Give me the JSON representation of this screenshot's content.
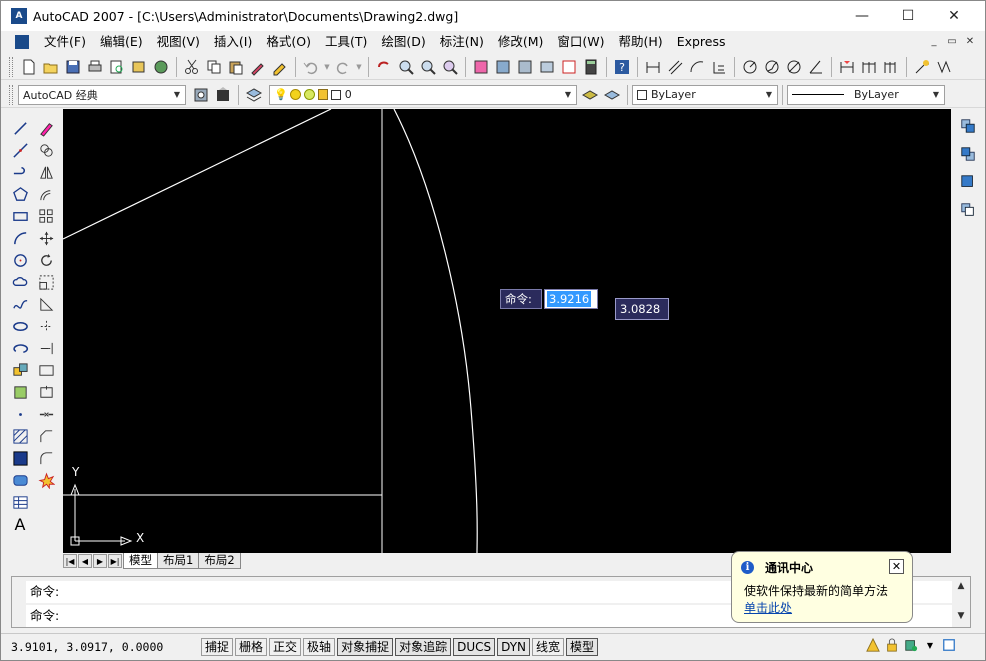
{
  "window": {
    "title": "AutoCAD 2007 - [C:\\Users\\Administrator\\Documents\\Drawing2.dwg]",
    "app_icon_text": "A",
    "minimize": "—",
    "maximize": "☐",
    "close": "✕"
  },
  "menubar": {
    "items": [
      "文件(F)",
      "编辑(E)",
      "视图(V)",
      "插入(I)",
      "格式(O)",
      "工具(T)",
      "绘图(D)",
      "标注(N)",
      "修改(M)",
      "窗口(W)",
      "帮助(H)",
      "Express"
    ],
    "mdi_minimize": "_",
    "mdi_restore": "▭",
    "mdi_close": "✕"
  },
  "toolbar2": {
    "workspace": "AutoCAD 经典",
    "layer": "0",
    "color": "ByLayer",
    "linetype": "ByLayer"
  },
  "command_popup": {
    "label": "命令:",
    "input_value": "3.9216",
    "second_value": "3.0828"
  },
  "ucs": {
    "x_label": "X",
    "y_label": "Y"
  },
  "layout_tabs": {
    "nav": [
      "|◀",
      "◀",
      "▶",
      "▶|"
    ],
    "tabs": [
      "模型",
      "布局1",
      "布局2"
    ],
    "active": "模型"
  },
  "command_window": {
    "line1": "命令:",
    "line2": "命令:"
  },
  "statusbar": {
    "coords": "3.9101, 3.0917, 0.0000",
    "buttons": [
      "捕捉",
      "栅格",
      "正交",
      "极轴",
      "对象捕捉",
      "对象追踪",
      "DUCS",
      "DYN",
      "线宽",
      "模型"
    ],
    "active": [
      "对象捕捉",
      "对象追踪",
      "DUCS",
      "DYN",
      "模型"
    ]
  },
  "balloon": {
    "title": "通讯中心",
    "message": "使软件保持最新的简单方法",
    "link": "单击此处"
  },
  "colors": {
    "canvas": "#000000",
    "popup_bg": "#2b2b5c",
    "selection": "#3399ff",
    "balloon_bg": "#ffffe1",
    "link": "#0645ad"
  }
}
